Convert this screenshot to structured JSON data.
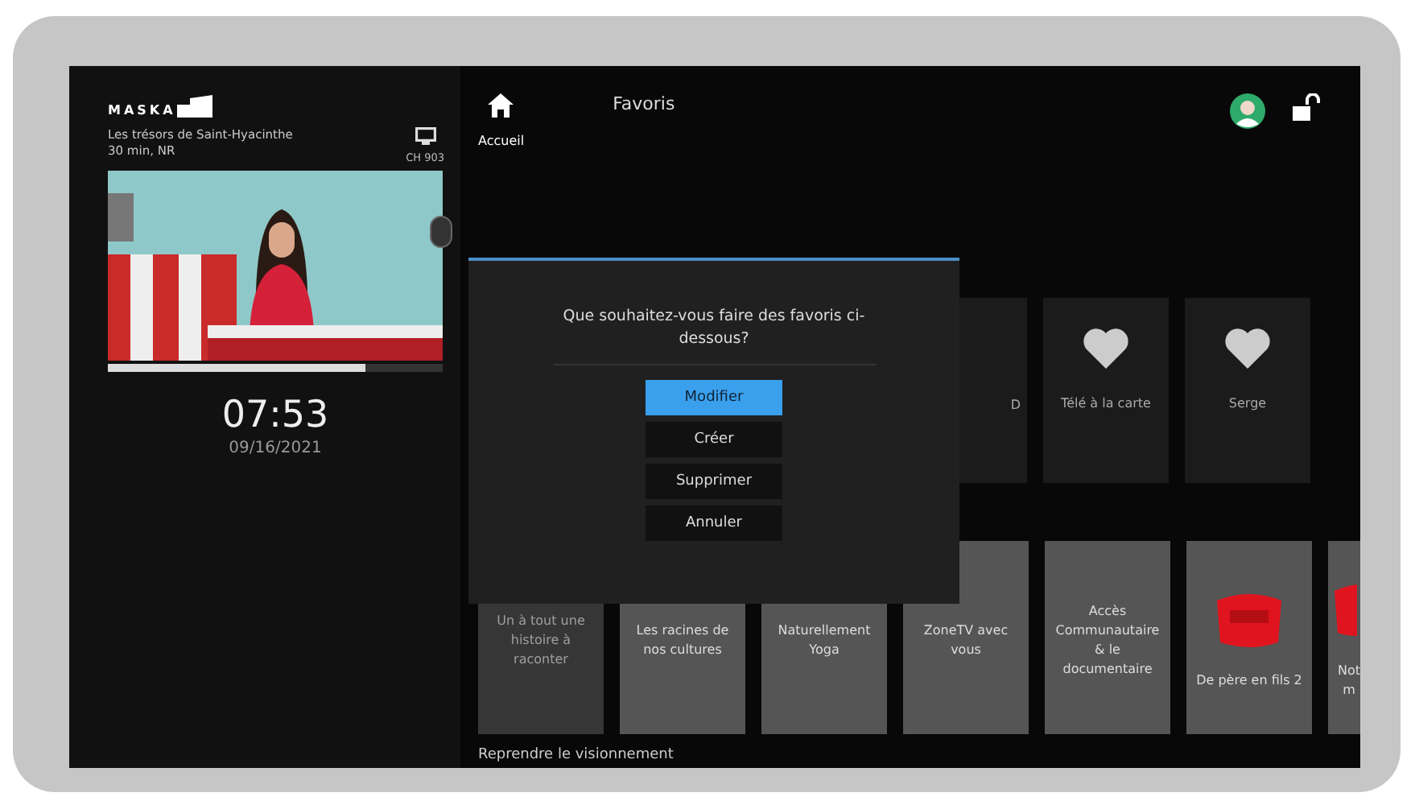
{
  "logo": "MASKA",
  "now_playing": {
    "title": "Les trésors de Saint-Hyacinthe",
    "info": "30 min, NR",
    "channel": "CH 903",
    "kind": "picture",
    "level": 0.77
  },
  "clock": {
    "time": "07:53",
    "date": "09/16/2021"
  },
  "header": {
    "home_label": "Accueil",
    "title": "Favoris"
  },
  "top_row": [
    {
      "label": "D",
      "kind": "partial"
    },
    {
      "label": "Télé à la carte",
      "kind": "heart"
    },
    {
      "label": "Serge",
      "kind": "heart"
    }
  ],
  "bottom_row": [
    {
      "label": "Un à tout une histoire à raconter",
      "kind": "plain",
      "disabled": true
    },
    {
      "label": "Les racines de nos cultures",
      "kind": "plain",
      "disabled": false
    },
    {
      "label": "Naturellement Yoga",
      "kind": "plain",
      "disabled": false
    },
    {
      "label": "ZoneTV avec vous",
      "kind": "plain",
      "disabled": false
    },
    {
      "label": "Accès Communautaire & le documentaire",
      "kind": "plain",
      "disabled": false
    },
    {
      "label": "De père en fils 2",
      "kind": "logo",
      "disabled": false
    },
    {
      "label": "Not m",
      "kind": "cut",
      "disabled": false
    }
  ],
  "section_title": "Reprendre le visionnement",
  "dialog": {
    "question": "Que souhaitez-vous faire des favoris ci-dessous?",
    "options": [
      {
        "label": "Modifier",
        "selected": true
      },
      {
        "label": "Créer",
        "selected": false
      },
      {
        "label": "Supprimer",
        "selected": false
      },
      {
        "label": "Annuler",
        "selected": false
      }
    ]
  }
}
